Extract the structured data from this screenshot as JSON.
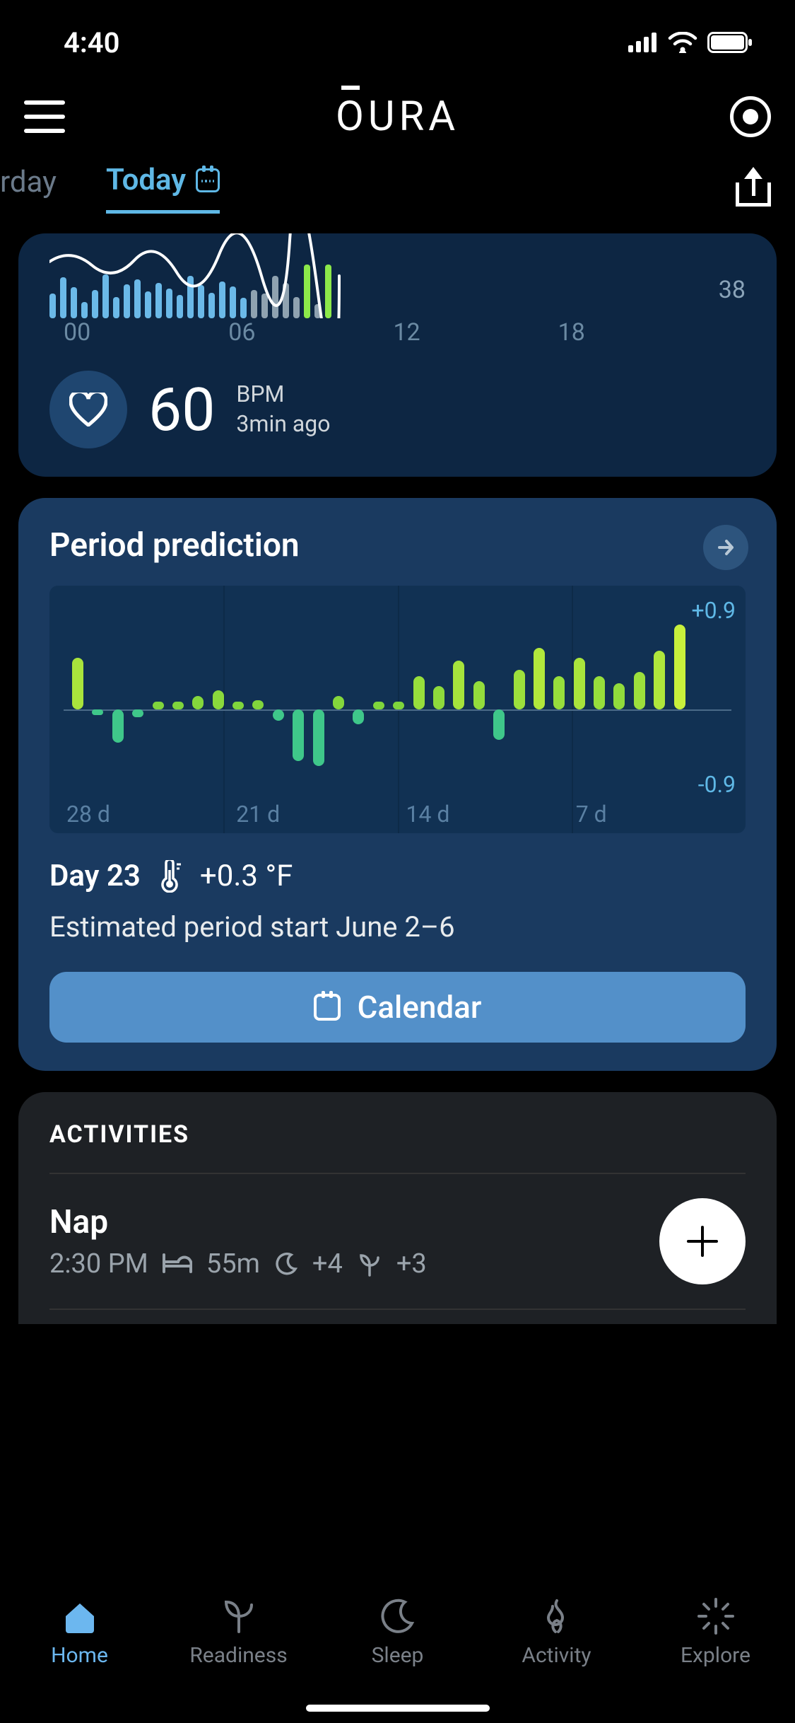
{
  "status": {
    "time": "4:40"
  },
  "header": {
    "logo": "OURA"
  },
  "tabs": {
    "prev": "rday",
    "current": "Today"
  },
  "hr": {
    "min_value": "38",
    "x_labels": [
      "00",
      "06",
      "12",
      "18"
    ],
    "value": "60",
    "unit": "BPM",
    "ago": "3min ago"
  },
  "period": {
    "title": "Period prediction",
    "y_max": "+0.9",
    "y_min": "-0.9",
    "x_labels": [
      "28 d",
      "21 d",
      "14 d",
      "7 d"
    ],
    "day_label": "Day 23",
    "temp_delta": "+0.3 °F",
    "estimate": "Estimated period start June 2–6",
    "button": "Calendar"
  },
  "activities": {
    "title": "ACTIVITIES",
    "items": [
      {
        "name": "Nap",
        "time": "2:30 PM",
        "duration": "55m",
        "sleep_plus": "+4",
        "recovery_plus": "+3"
      }
    ]
  },
  "nav": {
    "home": "Home",
    "readiness": "Readiness",
    "sleep": "Sleep",
    "activity": "Activity",
    "explore": "Explore"
  },
  "chart_data": [
    {
      "type": "bar",
      "title": "Heart rate (partial)",
      "categories": [
        "00",
        "06",
        "12",
        "18"
      ],
      "ylim": [
        38,
        100
      ],
      "bars": [
        {
          "h": 35,
          "c": "#6bb9e8"
        },
        {
          "h": 58,
          "c": "#6bb9e8"
        },
        {
          "h": 44,
          "c": "#6bb9e8"
        },
        {
          "h": 23,
          "c": "#6bb9e8"
        },
        {
          "h": 40,
          "c": "#6bb9e8"
        },
        {
          "h": 62,
          "c": "#6bb9e8"
        },
        {
          "h": 30,
          "c": "#6bb9e8"
        },
        {
          "h": 48,
          "c": "#6bb9e8"
        },
        {
          "h": 55,
          "c": "#6bb9e8"
        },
        {
          "h": 38,
          "c": "#6bb9e8"
        },
        {
          "h": 50,
          "c": "#6bb9e8"
        },
        {
          "h": 42,
          "c": "#6bb9e8"
        },
        {
          "h": 33,
          "c": "#6bb9e8"
        },
        {
          "h": 60,
          "c": "#6bb9e8"
        },
        {
          "h": 47,
          "c": "#6bb9e8"
        },
        {
          "h": 36,
          "c": "#6bb9e8"
        },
        {
          "h": 52,
          "c": "#6bb9e8"
        },
        {
          "h": 45,
          "c": "#6bb9e8"
        },
        {
          "h": 29,
          "c": "#6bb9e8"
        },
        {
          "h": 40,
          "c": "#8fa2b0"
        },
        {
          "h": 35,
          "c": "#8fa2b0"
        },
        {
          "h": 60,
          "c": "#8fa2b0"
        },
        {
          "h": 50,
          "c": "#8fa2b0"
        },
        {
          "h": 30,
          "c": "#8fa2b0"
        },
        {
          "h": 76,
          "c": "#8ce84a"
        },
        {
          "h": 20,
          "c": "#8fa2b0"
        },
        {
          "h": 76,
          "c": "#8ce84a"
        }
      ]
    },
    {
      "type": "bar",
      "title": "Period prediction temperature deviation",
      "xlabel_ticks": [
        "28 d",
        "21 d",
        "14 d",
        "7 d"
      ],
      "ylim": [
        -0.9,
        0.9
      ],
      "values": [
        0.55,
        -0.06,
        -0.35,
        -0.08,
        0.08,
        0.08,
        0.14,
        0.2,
        0.08,
        0.1,
        -0.12,
        -0.55,
        -0.6,
        0.14,
        -0.16,
        0.08,
        0.08,
        0.35,
        0.25,
        0.52,
        0.3,
        -0.32,
        0.42,
        0.65,
        0.35,
        0.55,
        0.35,
        0.28,
        0.4,
        0.62,
        0.9
      ]
    }
  ]
}
